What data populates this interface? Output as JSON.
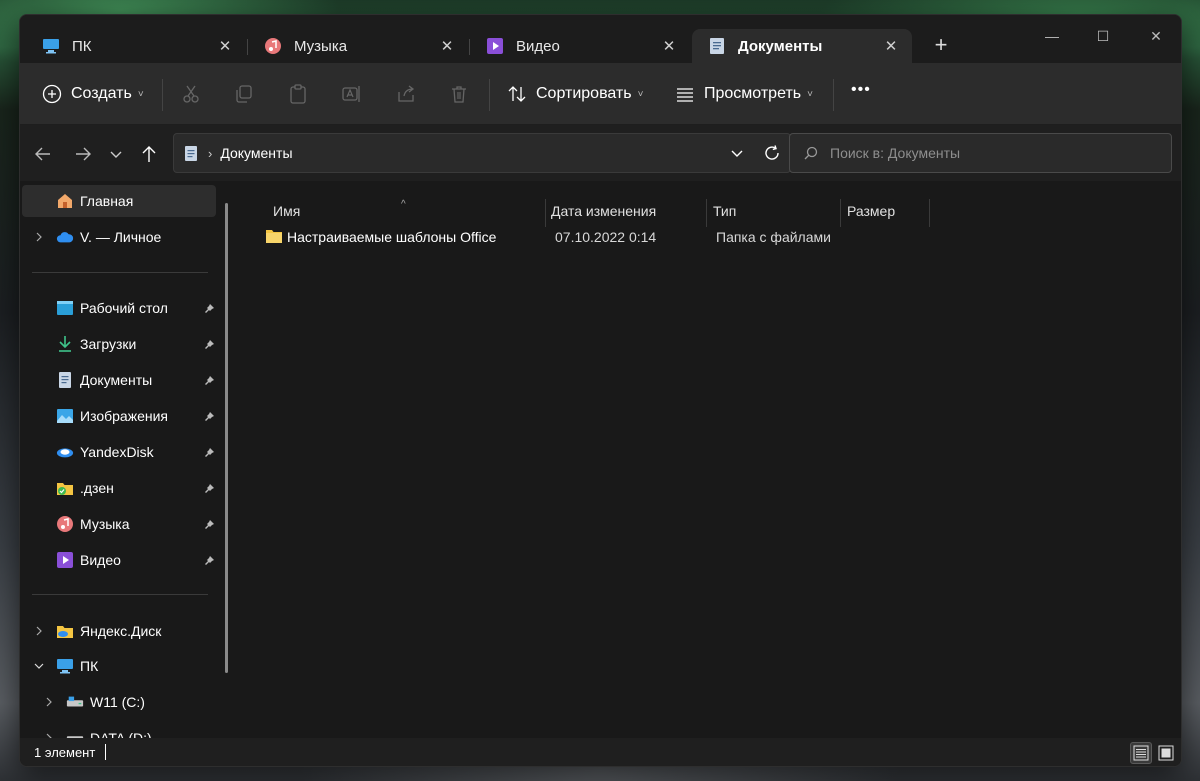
{
  "tabs": [
    {
      "label": "ПК",
      "icon": "monitor-icon"
    },
    {
      "label": "Музыка",
      "icon": "music-icon"
    },
    {
      "label": "Видео",
      "icon": "video-icon"
    },
    {
      "label": "Документы",
      "icon": "document-icon",
      "active": true
    }
  ],
  "new_tab_glyph": "+",
  "toolbar": {
    "create_label": "Создать",
    "sort_label": "Сортировать",
    "view_label": "Просмотреть",
    "more_glyph": "•••"
  },
  "address": {
    "breadcrumb": "Документы"
  },
  "search": {
    "placeholder": "Поиск в: Документы"
  },
  "sidebar": {
    "home": "Главная",
    "onedrive": "V. — Личное",
    "pinned": [
      {
        "label": "Рабочий стол",
        "icon": "desktop-icon"
      },
      {
        "label": "Загрузки",
        "icon": "download-icon"
      },
      {
        "label": "Документы",
        "icon": "document-icon"
      },
      {
        "label": "Изображения",
        "icon": "pictures-icon"
      },
      {
        "label": "YandexDisk",
        "icon": "yandex-disk-icon"
      },
      {
        "label": ".дзен",
        "icon": "folder-sync-icon"
      },
      {
        "label": "Музыка",
        "icon": "music-icon"
      },
      {
        "label": "Видео",
        "icon": "video-icon"
      }
    ],
    "yandex": "Яндекс.Диск",
    "pc": "ПК",
    "drives": [
      "W11 (C:)",
      "DATA (D:)"
    ]
  },
  "columns": {
    "name": "Имя",
    "date": "Дата изменения",
    "type": "Тип",
    "size": "Размер"
  },
  "files": [
    {
      "name": "Настраиваемые шаблоны Office",
      "date": "07.10.2022 0:14",
      "type": "Папка с файлами",
      "size": ""
    }
  ],
  "status": {
    "count": "1 элемент"
  },
  "colors": {
    "window_bg": "#191919",
    "toolbar_bg": "#2c2c2c",
    "folder_yellow": "#f4c542",
    "accent_blue": "#4cc2ff"
  }
}
